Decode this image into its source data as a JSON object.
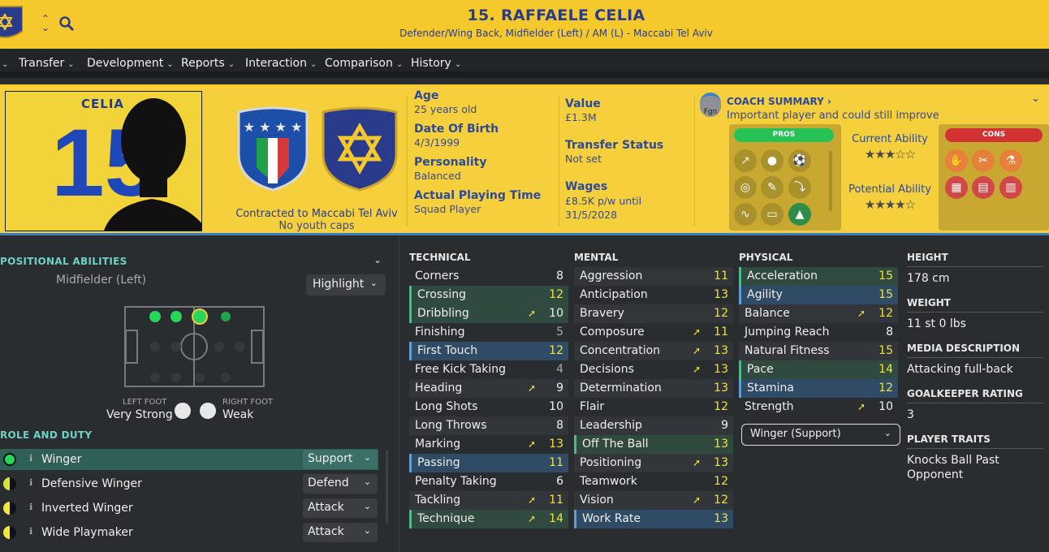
{
  "header": {
    "title": "15. RAFFAELE CELIA",
    "subtitle": "Defender/Wing Back, Midfielder (Left) / AM (L) - Maccabi Tel Aviv"
  },
  "menu": [
    {
      "label": "Transfer"
    },
    {
      "label": "Development"
    },
    {
      "label": "Reports"
    },
    {
      "label": "Interaction"
    },
    {
      "label": "Comparison"
    },
    {
      "label": "History"
    }
  ],
  "photo": {
    "jersey_name": "CELIA",
    "jersey_number": "15"
  },
  "contract": {
    "line1": "Contracted to Maccabi Tel Aviv",
    "line2": "No youth caps"
  },
  "details_left": [
    {
      "label": "Age",
      "value": "25 years old"
    },
    {
      "label": "Date Of Birth",
      "value": "4/3/1999"
    },
    {
      "label": "Personality",
      "value": "Balanced"
    },
    {
      "label": "Actual Playing Time",
      "value": "Squad Player"
    }
  ],
  "details_right": {
    "value_label": "Value",
    "value": "£1.3M",
    "transfer_label": "Transfer Status",
    "transfer": "Not set",
    "wages_label": "Wages",
    "wages": "£8.5K p/w until 31/5/2028"
  },
  "coach": {
    "badge": "Fgn",
    "title": "COACH SUMMARY",
    "text": "Important player and could still improve",
    "pros_label": "PROS",
    "cons_label": "CONS",
    "current_ability_label": "Current Ability",
    "potential_ability_label": "Potential Ability",
    "current_stars": "★★★☆☆",
    "potential_stars": "★★★★☆"
  },
  "positional": {
    "title": "POSITIONAL ABILITIES",
    "role": "Midfielder (Left)",
    "highlight": "Highlight",
    "left_foot_label": "LEFT FOOT",
    "left_foot": "Very Strong",
    "right_foot_label": "RIGHT FOOT",
    "right_foot": "Weak"
  },
  "role_duty": {
    "title": "ROLE AND DUTY",
    "roles": [
      {
        "name": "Winger",
        "duty": "Support"
      },
      {
        "name": "Defensive Winger",
        "duty": "Defend"
      },
      {
        "name": "Inverted Winger",
        "duty": "Attack"
      },
      {
        "name": "Wide Playmaker",
        "duty": "Attack"
      }
    ]
  },
  "technical": {
    "title": "TECHNICAL",
    "attrs": [
      {
        "name": "Corners",
        "value": "8"
      },
      {
        "name": "Crossing",
        "value": "12"
      },
      {
        "name": "Dribbling",
        "value": "10"
      },
      {
        "name": "Finishing",
        "value": "5"
      },
      {
        "name": "First Touch",
        "value": "12"
      },
      {
        "name": "Free Kick Taking",
        "value": "4"
      },
      {
        "name": "Heading",
        "value": "9"
      },
      {
        "name": "Long Shots",
        "value": "10"
      },
      {
        "name": "Long Throws",
        "value": "8"
      },
      {
        "name": "Marking",
        "value": "13"
      },
      {
        "name": "Passing",
        "value": "11"
      },
      {
        "name": "Penalty Taking",
        "value": "6"
      },
      {
        "name": "Tackling",
        "value": "11"
      },
      {
        "name": "Technique",
        "value": "14"
      }
    ]
  },
  "mental": {
    "title": "MENTAL",
    "attrs": [
      {
        "name": "Aggression",
        "value": "11"
      },
      {
        "name": "Anticipation",
        "value": "13"
      },
      {
        "name": "Bravery",
        "value": "12"
      },
      {
        "name": "Composure",
        "value": "11"
      },
      {
        "name": "Concentration",
        "value": "13"
      },
      {
        "name": "Decisions",
        "value": "13"
      },
      {
        "name": "Determination",
        "value": "13"
      },
      {
        "name": "Flair",
        "value": "12"
      },
      {
        "name": "Leadership",
        "value": "9"
      },
      {
        "name": "Off The Ball",
        "value": "13"
      },
      {
        "name": "Positioning",
        "value": "13"
      },
      {
        "name": "Teamwork",
        "value": "12"
      },
      {
        "name": "Vision",
        "value": "12"
      },
      {
        "name": "Work Rate",
        "value": "13"
      }
    ]
  },
  "physical": {
    "title": "PHYSICAL",
    "attrs": [
      {
        "name": "Acceleration",
        "value": "15"
      },
      {
        "name": "Agility",
        "value": "15"
      },
      {
        "name": "Balance",
        "value": "12"
      },
      {
        "name": "Jumping Reach",
        "value": "8"
      },
      {
        "name": "Natural Fitness",
        "value": "15"
      },
      {
        "name": "Pace",
        "value": "14"
      },
      {
        "name": "Stamina",
        "value": "12"
      },
      {
        "name": "Strength",
        "value": "10"
      }
    ],
    "role_select": "Winger (Support)"
  },
  "bio": {
    "height_label": "HEIGHT",
    "height": "178 cm",
    "weight_label": "WEIGHT",
    "weight": "11 st 0 lbs",
    "media_label": "MEDIA DESCRIPTION",
    "media": "Attacking full-back",
    "gk_label": "GOALKEEPER RATING",
    "gk": "3",
    "traits_label": "PLAYER TRAITS",
    "traits": "Knocks Ball Past Opponent"
  }
}
